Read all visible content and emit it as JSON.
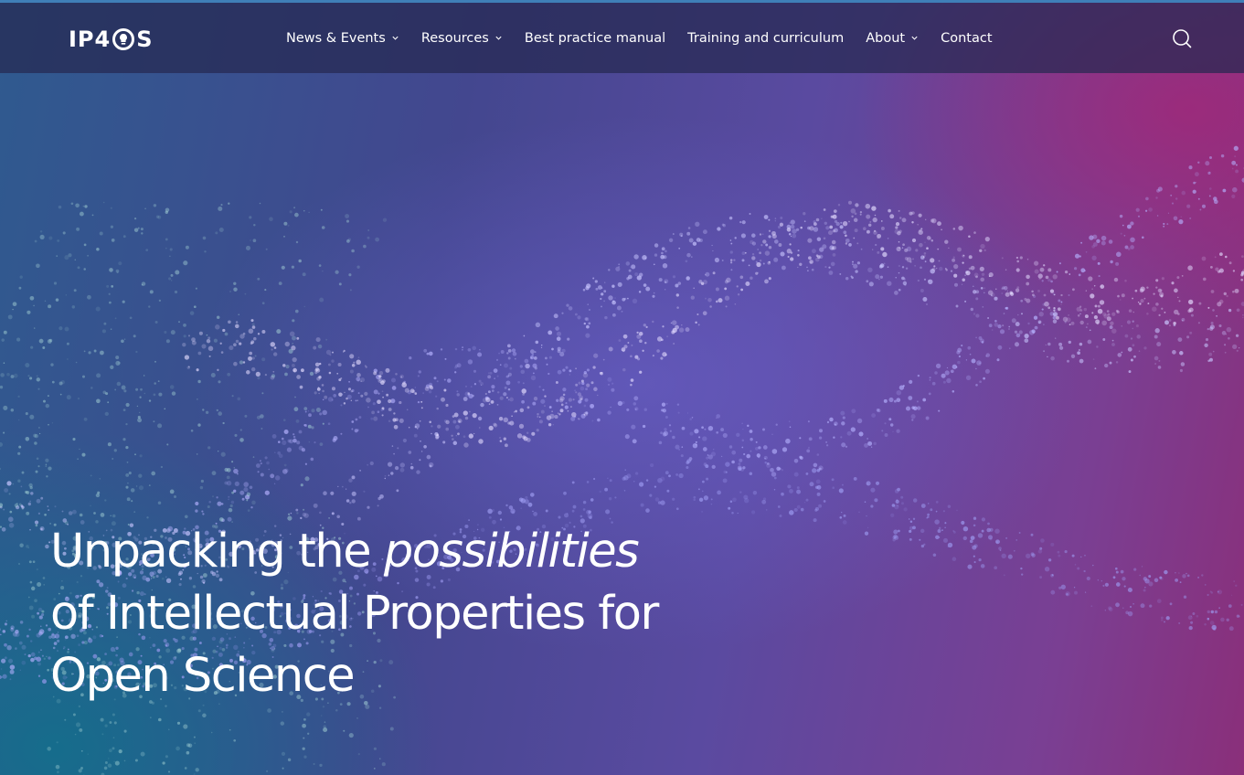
{
  "brand": {
    "logo_text_left": "IP4",
    "logo_text_right": "S"
  },
  "nav": {
    "items": [
      {
        "label": "News & Events",
        "dropdown": true
      },
      {
        "label": "Resources",
        "dropdown": true
      },
      {
        "label": "Best practice manual",
        "dropdown": false
      },
      {
        "label": "Training and curriculum",
        "dropdown": false
      },
      {
        "label": "About",
        "dropdown": true
      },
      {
        "label": "Contact",
        "dropdown": false
      }
    ],
    "search_icon": "search-icon"
  },
  "hero": {
    "title_part1": "Unpacking the ",
    "title_emphasis": "possibilities",
    "title_line2": "of Intellectual Properties for",
    "title_line3": "Open Science"
  },
  "colors": {
    "header_bg": "#262850",
    "accent_line": "#3f7fb8",
    "text": "#ffffff"
  }
}
